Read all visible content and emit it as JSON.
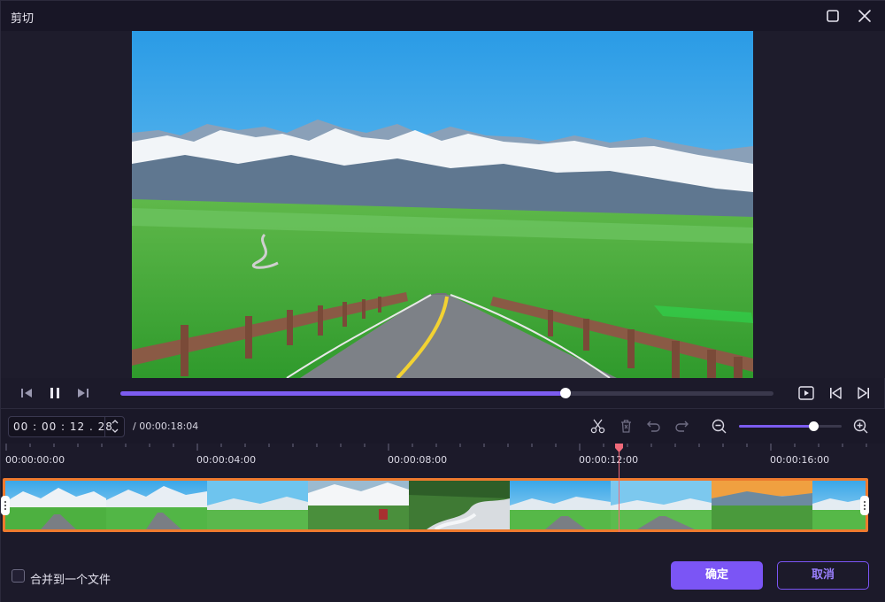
{
  "window": {
    "title": "剪切"
  },
  "player": {
    "progress_fraction": 0.682
  },
  "time_input": {
    "value": "00 : 00 : 12 . 28"
  },
  "total_time": "/ 00:00:18:04",
  "zoom": {
    "level_fraction": 0.72
  },
  "timeline": {
    "ticks": [
      "00:00:00:00",
      "00:00:04:00",
      "00:00:08:00",
      "00:00:12:00",
      "00:00:16:00"
    ],
    "playhead_time": "00:00:12:28"
  },
  "footer": {
    "merge_label": "合并到一个文件",
    "merge_checked": false,
    "ok_label": "确定",
    "cancel_label": "取消"
  },
  "colors": {
    "accent": "#7b55f5",
    "clip_border": "#ee7a2e",
    "playhead": "#f06a7a"
  }
}
